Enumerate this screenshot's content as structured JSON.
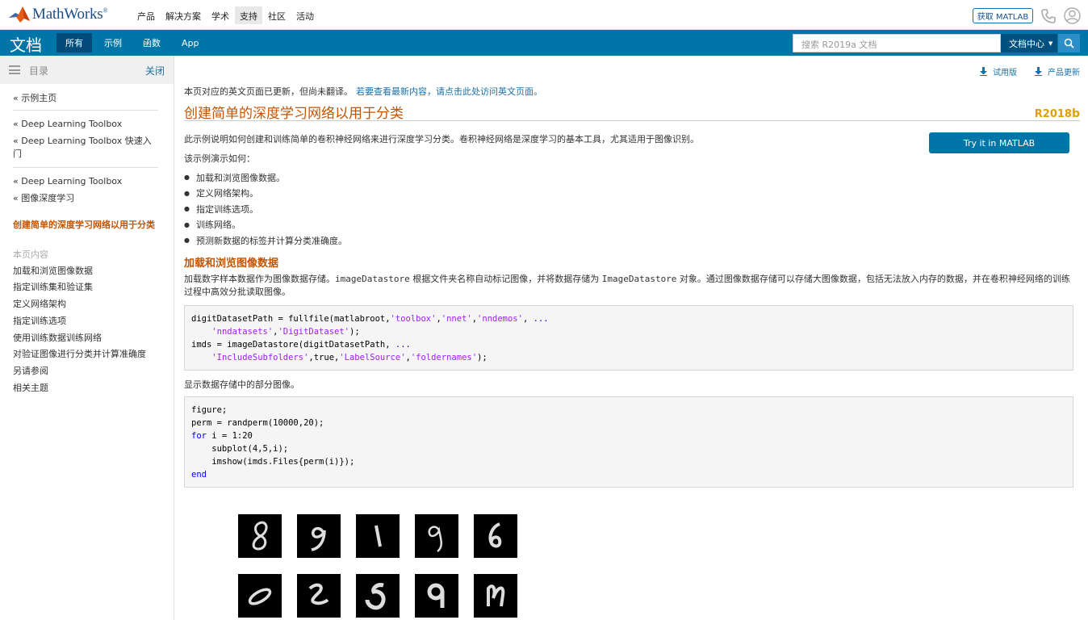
{
  "brand": {
    "logo_text": "MathWorks",
    "reg": "®"
  },
  "top_nav": [
    "产品",
    "解决方案",
    "学术",
    "支持",
    "社区",
    "活动"
  ],
  "top_nav_active_index": 3,
  "header_actions": {
    "get_matlab": "获取 MATLAB",
    "phone_icon": "phone-icon",
    "user_icon": "user-icon"
  },
  "docbar": {
    "title": "文档",
    "tabs": [
      "所有",
      "示例",
      "函数",
      "App"
    ],
    "active_tab_index": 0,
    "search_placeholder": "搜索 R2019a 文档",
    "scope": "文档中心",
    "bg_color": "#0076a8"
  },
  "sidebar": {
    "toc_label": "目录",
    "close_label": "关闭",
    "crumbs_group1": [
      "« 示例主页"
    ],
    "crumbs_group2": [
      "« Deep Learning Toolbox",
      "« Deep Learning Toolbox 快速入门"
    ],
    "crumbs_group3": [
      "« Deep Learning Toolbox",
      "« 图像深度学习"
    ],
    "current_page": "创建简单的深度学习网络以用于分类",
    "on_this_page": "本页内容",
    "sections": [
      "加载和浏览图像数据",
      "指定训练集和验证集",
      "定义网络架构",
      "指定训练选项",
      "使用训练数据训练网络",
      "对验证图像进行分类并计算准确度",
      "另请参阅",
      "相关主题"
    ]
  },
  "main": {
    "tool_links": [
      "试用版",
      "产品更新"
    ],
    "notice": "本页对应的英文页面已更新，但尚未翻译。",
    "notice_link": "若要查看最新内容，请点击此处访问英文页面。",
    "title": "创建简单的深度学习网络以用于分类",
    "release": "R2018",
    "release_suffix": "b",
    "intro": "此示例说明如何创建和训练简单的卷积神经网络来进行深度学习分类。卷积神经网络是深度学习的基本工具，尤其适用于图像识别。",
    "try_button": "Try it in MATLAB",
    "demo_lead": "该示例演示如何：",
    "bullets": [
      "加载和浏览图像数据。",
      "定义网络架构。",
      "指定训练选项。",
      "训练网络。",
      "预测新数据的标签并计算分类准确度。"
    ],
    "section_heading": "加载和浏览图像数据",
    "para_1": "加载数字样本数据作为图像数据存储。",
    "para_code_1": "imageDatastore",
    "para_2": " 根据文件夹名称自动标记图像，并将数据存储为 ",
    "para_code_2": "ImageDatastore",
    "para_3": " 对象。通过图像数据存储可以存储大图像数据，包括无法放入内存的数据，并在卷积神经网络的训练过程中高效分批读取图像。",
    "code1": {
      "l1a": "digitDatasetPath = fullfile(matlabroot,",
      "l1s1": "'toolbox'",
      "l1c1": ",",
      "l1s2": "'nnet'",
      "l1c2": ",",
      "l1s3": "'nndemos'",
      "l1c3": ", ",
      "l1k": "...",
      "l2i": "    ",
      "l2s1": "'nndatasets'",
      "l2c": ",",
      "l2s2": "'DigitDataset'",
      "l2e": ");",
      "l3a": "imds = imageDatastore(digitDatasetPath, ",
      "l3k": "...",
      "l4i": "    ",
      "l4s1": "'IncludeSubfolders'",
      "l4c": ",true,",
      "l4s2": "'LabelSource'",
      "l4c2": ",",
      "l4s3": "'foldernames'",
      "l4e": ");"
    },
    "show_text": "显示数据存储中的部分图像。",
    "code2": {
      "l1": "figure;",
      "l2": "perm = randperm(10000,20);",
      "l3k": "for",
      "l3": " i = 1:20",
      "l4": "    subplot(4,5,i);",
      "l5": "    imshow(imds.Files{perm(i)});",
      "l6k": "end"
    },
    "digit_labels": [
      "8",
      "9",
      "1",
      "9",
      "6",
      "0",
      "2",
      "5",
      "9",
      "4"
    ]
  }
}
